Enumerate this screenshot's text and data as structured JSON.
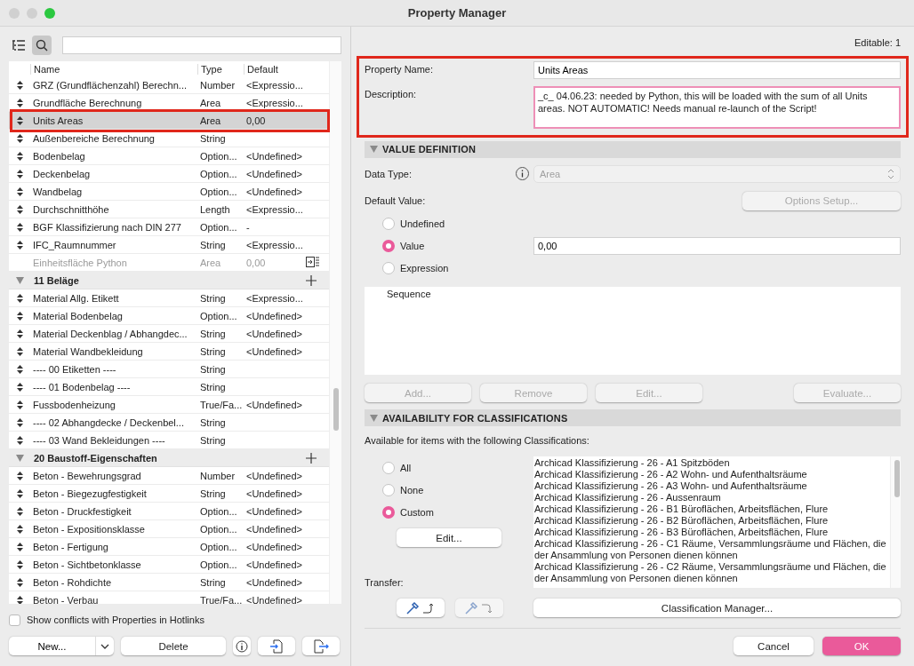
{
  "window": {
    "title": "Property Manager"
  },
  "left": {
    "columns": [
      "Name",
      "Type",
      "Default"
    ],
    "rows": [
      {
        "kind": "property",
        "name": "GRZ (Grundflächenzahl) Berechn...",
        "type": "Number",
        "default": "<Expressio...",
        "selected": false,
        "disabled": false
      },
      {
        "kind": "property",
        "name": "Grundfläche Berechnung",
        "type": "Area",
        "default": "<Expressio...",
        "selected": false,
        "disabled": false
      },
      {
        "kind": "property",
        "name": "Units Areas",
        "type": "Area",
        "default": "0,00",
        "selected": true,
        "disabled": false,
        "annotated": true
      },
      {
        "kind": "property",
        "name": "Außenbereiche Berechnung",
        "type": "String",
        "default": "",
        "selected": false,
        "disabled": false
      },
      {
        "kind": "property",
        "name": "Bodenbelag",
        "type": "Option...",
        "default": "<Undefined>",
        "selected": false,
        "disabled": false
      },
      {
        "kind": "property",
        "name": "Deckenbelag",
        "type": "Option...",
        "default": "<Undefined>",
        "selected": false,
        "disabled": false
      },
      {
        "kind": "property",
        "name": "Wandbelag",
        "type": "Option...",
        "default": "<Undefined>",
        "selected": false,
        "disabled": false
      },
      {
        "kind": "property",
        "name": "Durchschnitthöhe",
        "type": "Length",
        "default": "<Expressio...",
        "selected": false,
        "disabled": false
      },
      {
        "kind": "property",
        "name": "BGF Klassifizierung nach DIN 277",
        "type": "Option...",
        "default": "-",
        "selected": false,
        "disabled": false
      },
      {
        "kind": "property",
        "name": "IFC_Raumnummer",
        "type": "String",
        "default": "<Expressio...",
        "selected": false,
        "disabled": false
      },
      {
        "kind": "property",
        "name": "Einheitsfläche Python",
        "type": "Area",
        "default": "0,00",
        "selected": false,
        "disabled": true
      },
      {
        "kind": "group",
        "name": "11 Beläge",
        "expanded": true
      },
      {
        "kind": "property",
        "name": "Material Allg. Etikett",
        "type": "String",
        "default": "<Expressio...",
        "selected": false,
        "disabled": false
      },
      {
        "kind": "property",
        "name": "Material Bodenbelag",
        "type": "Option...",
        "default": "<Undefined>",
        "selected": false,
        "disabled": false
      },
      {
        "kind": "property",
        "name": "Material Deckenblag / Abhangdec...",
        "type": "String",
        "default": "<Undefined>",
        "selected": false,
        "disabled": false
      },
      {
        "kind": "property",
        "name": "Material Wandbekleidung",
        "type": "String",
        "default": "<Undefined>",
        "selected": false,
        "disabled": false
      },
      {
        "kind": "property",
        "name": "---- 00 Etiketten ----",
        "type": "String",
        "default": "",
        "selected": false,
        "disabled": false
      },
      {
        "kind": "property",
        "name": "---- 01 Bodenbelag ----",
        "type": "String",
        "default": "",
        "selected": false,
        "disabled": false
      },
      {
        "kind": "property",
        "name": "Fussbodenheizung",
        "type": "True/Fa...",
        "default": "<Undefined>",
        "selected": false,
        "disabled": false
      },
      {
        "kind": "property",
        "name": "---- 02 Abhangdecke / Deckenbel...",
        "type": "String",
        "default": "",
        "selected": false,
        "disabled": false
      },
      {
        "kind": "property",
        "name": "---- 03 Wand Bekleidungen ----",
        "type": "String",
        "default": "",
        "selected": false,
        "disabled": false
      },
      {
        "kind": "group",
        "name": "20 Baustoff-Eigenschaften",
        "expanded": true
      },
      {
        "kind": "property",
        "name": "Beton - Bewehrungsgrad",
        "type": "Number",
        "default": "<Undefined>",
        "selected": false,
        "disabled": false
      },
      {
        "kind": "property",
        "name": "Beton - Biegezugfestigkeit",
        "type": "String",
        "default": "<Undefined>",
        "selected": false,
        "disabled": false
      },
      {
        "kind": "property",
        "name": "Beton - Druckfestigkeit",
        "type": "Option...",
        "default": "<Undefined>",
        "selected": false,
        "disabled": false
      },
      {
        "kind": "property",
        "name": "Beton - Expositionsklasse",
        "type": "Option...",
        "default": "<Undefined>",
        "selected": false,
        "disabled": false
      },
      {
        "kind": "property",
        "name": "Beton - Fertigung",
        "type": "Option...",
        "default": "<Undefined>",
        "selected": false,
        "disabled": false
      },
      {
        "kind": "property",
        "name": "Beton - Sichtbetonklasse",
        "type": "Option...",
        "default": "<Undefined>",
        "selected": false,
        "disabled": false
      },
      {
        "kind": "property",
        "name": "Beton - Rohdichte",
        "type": "String",
        "default": "<Undefined>",
        "selected": false,
        "disabled": false
      },
      {
        "kind": "property",
        "name": "Beton - Verbau",
        "type": "True/Fa...",
        "default": "<Undefined>",
        "selected": false,
        "disabled": false
      }
    ],
    "show_conflicts": {
      "label": "Show conflicts with Properties in Hotlinks",
      "checked": false
    },
    "buttons": {
      "new": "New...",
      "delete": "Delete"
    }
  },
  "right": {
    "editable": "Editable: 1",
    "property": {
      "annotated": true,
      "name_label": "Property Name:",
      "name": "Units Areas",
      "description_label": "Description:",
      "description": "_c_ 04.06.23: needed by Python, this will be loaded with the sum of all Units areas. NOT AUTOMATIC! Needs manual re-launch of the Script!"
    },
    "value_definition": {
      "title": "VALUE DEFINITION",
      "expanded": true,
      "data_type_label": "Data Type:",
      "data_type": {
        "value": "Area",
        "disabled": true
      },
      "default_label": "Default Value:",
      "options_setup": {
        "label": "Options Setup...",
        "disabled": true
      },
      "options": [
        {
          "label": "Undefined",
          "selected": false
        },
        {
          "label": "Value",
          "selected": true
        },
        {
          "label": "Expression",
          "selected": false
        }
      ],
      "value": "0,00",
      "sequence_column": "Sequence",
      "buttons": [
        {
          "label": "Add...",
          "disabled": true
        },
        {
          "label": "Remove",
          "disabled": true
        },
        {
          "label": "Edit...",
          "disabled": true
        },
        {
          "label": "Evaluate...",
          "disabled": true
        }
      ]
    },
    "availability": {
      "title": "AVAILABILITY FOR CLASSIFICATIONS",
      "expanded": true,
      "intro": "Available for items with the following Classifications:",
      "options": [
        {
          "label": "All",
          "selected": false
        },
        {
          "label": "None",
          "selected": false
        },
        {
          "label": "Custom",
          "selected": true
        }
      ],
      "edit": "Edit...",
      "transfer_label": "Transfer:",
      "transfer_buttons": [
        {
          "disabled": false
        },
        {
          "disabled": true
        }
      ],
      "classifications": [
        "Archicad Klassifizierung - 26 - A1 Spitzböden",
        "Archicad Klassifizierung - 26 - A2 Wohn- und Aufenthaltsräume",
        "Archicad Klassifizierung - 26 - A3 Wohn- und Aufenthaltsräume",
        "Archicad Klassifizierung - 26 - Aussenraum",
        "Archicad Klassifizierung - 26 - B1 Büroflächen, Arbeitsflächen, Flure",
        "Archicad Klassifizierung - 26 - B2 Büroflächen, Arbeitsflächen, Flure",
        "Archicad Klassifizierung - 26 - B3 Büroflächen, Arbeitsflächen, Flure",
        "Archicad Klassifizierung - 26 - C1 Räume, Versammlungsräume und Flächen, die der Ansammlung von Personen dienen können",
        "Archicad Klassifizierung - 26 - C2 Räume, Versammlungsräume und Flächen, die der Ansammlung von Personen dienen können"
      ],
      "manager": "Classification Manager..."
    },
    "cancel": "Cancel",
    "ok": "OK"
  }
}
